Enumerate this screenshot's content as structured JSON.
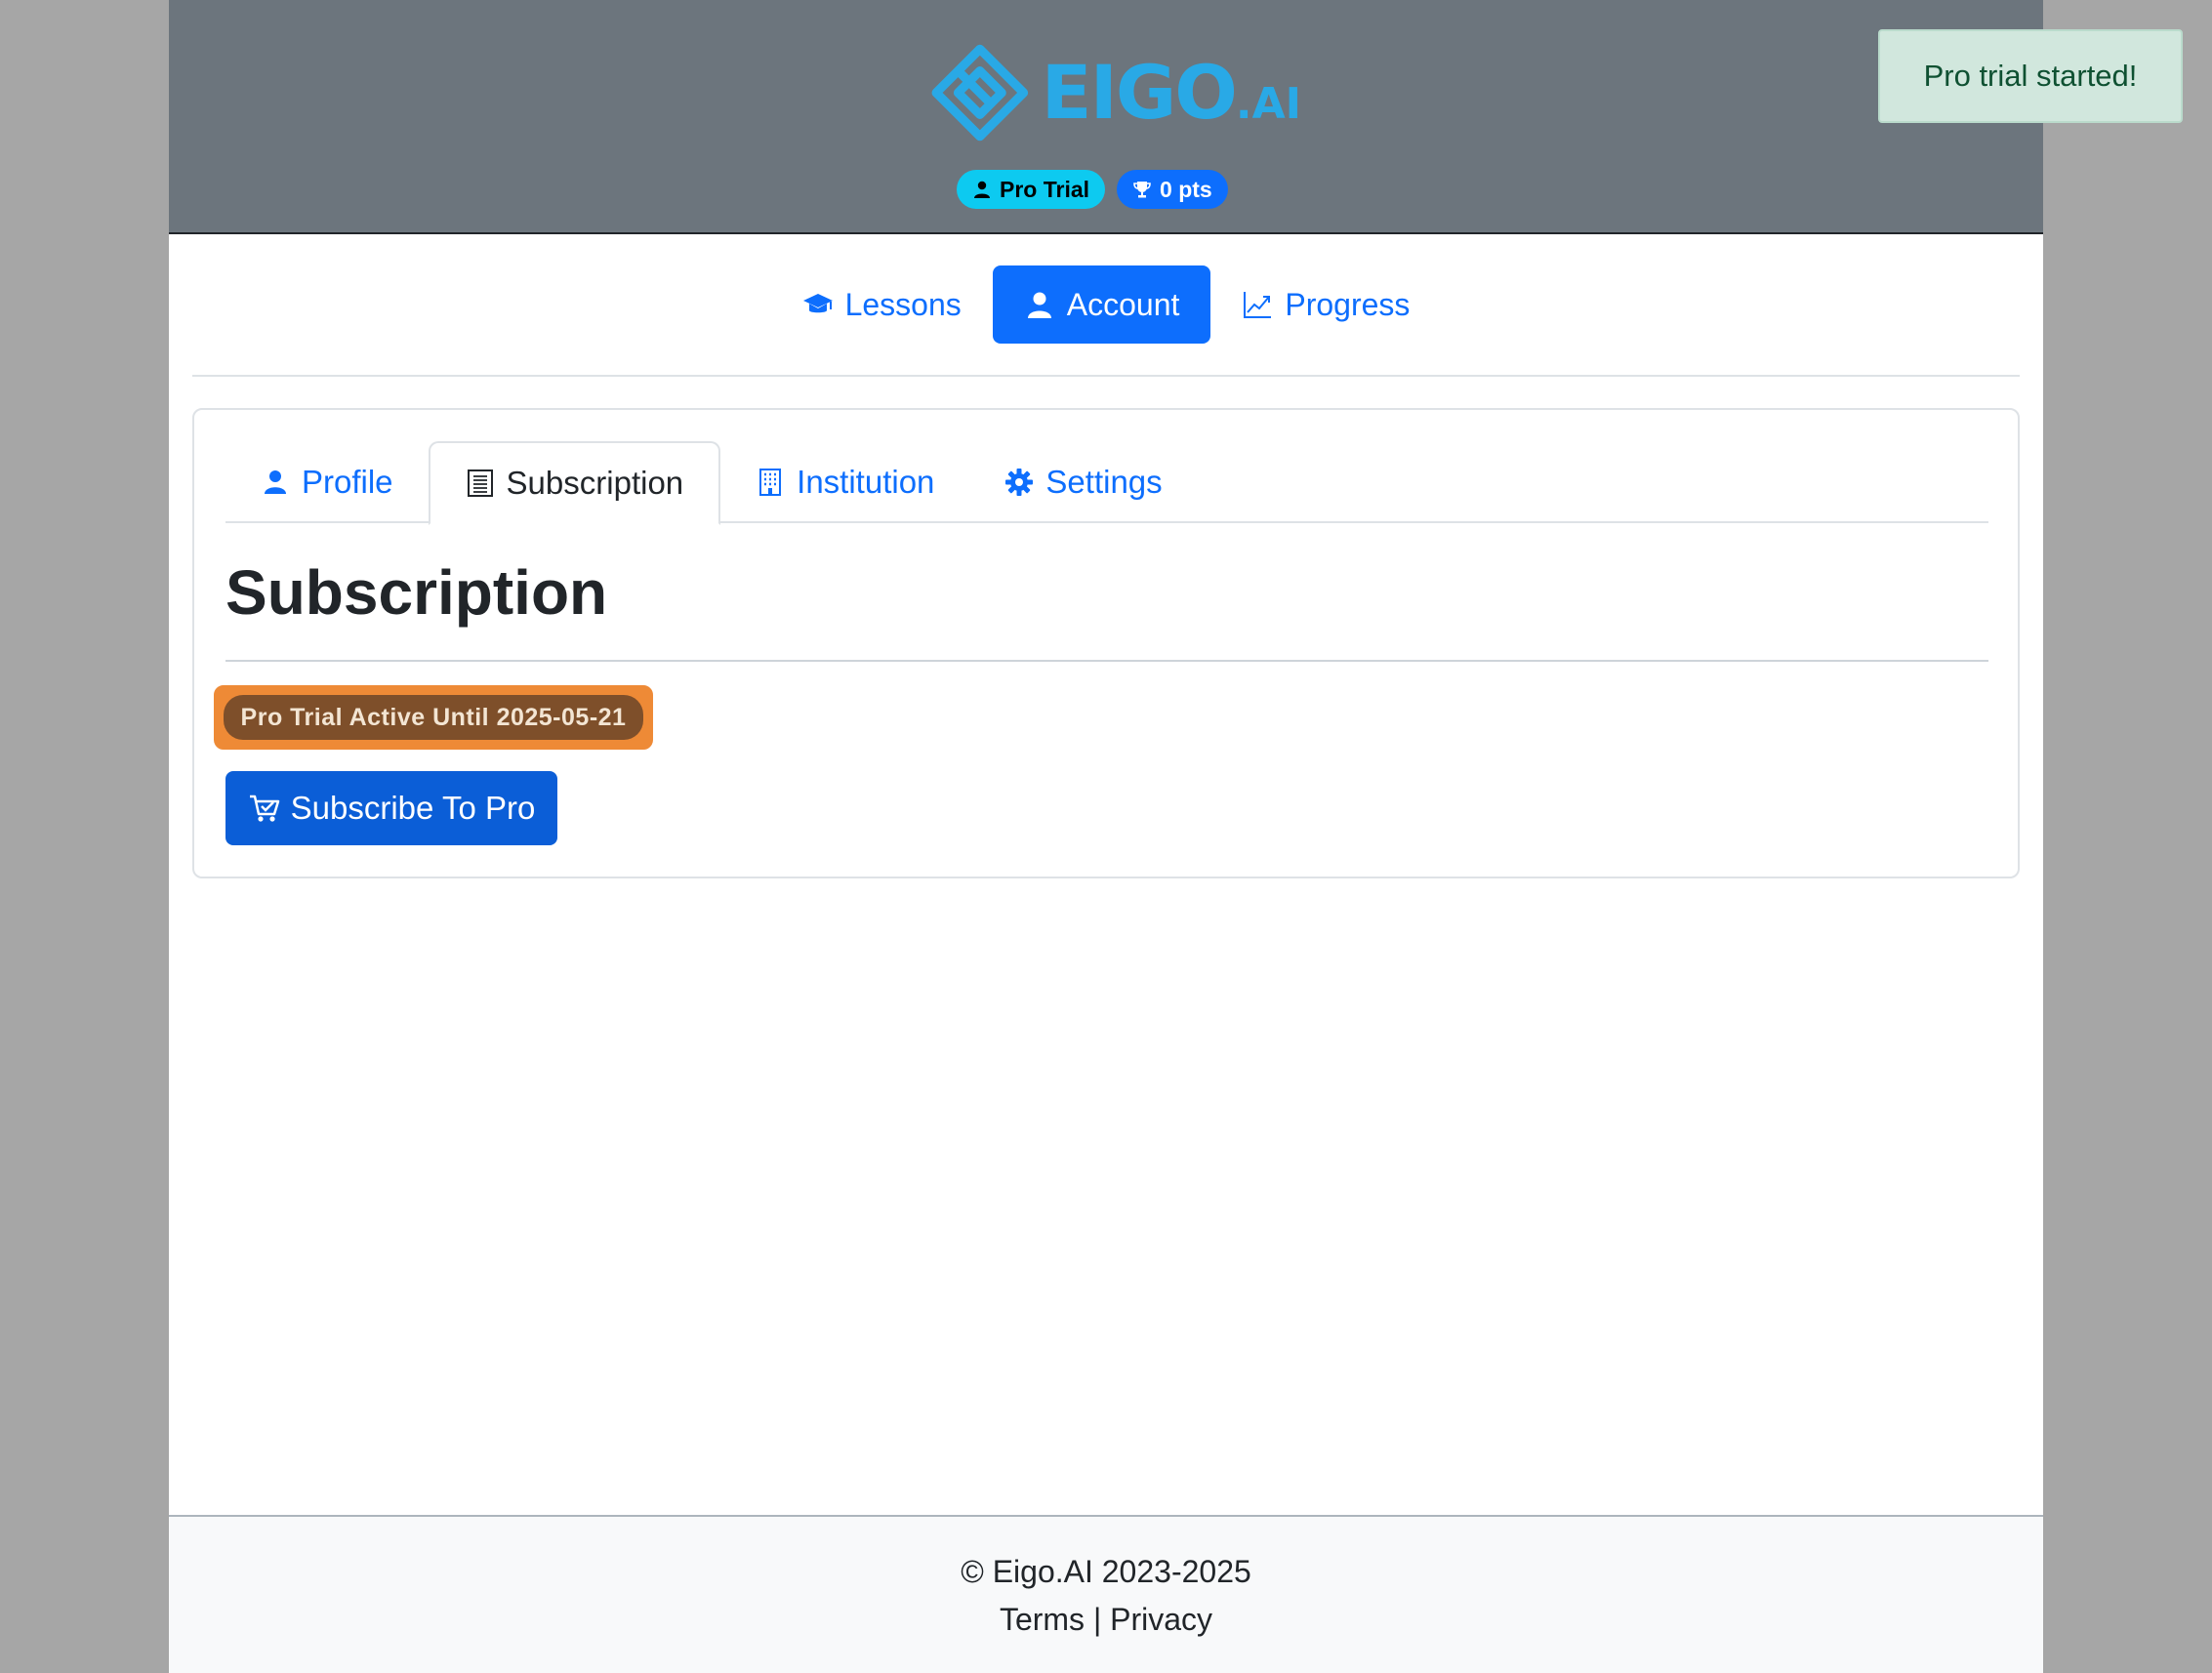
{
  "header": {
    "logo": {
      "brand": "EIGO",
      "suffix": ".AI",
      "color": "#29a9e6"
    },
    "badges": {
      "plan": {
        "label": "Pro Trial",
        "icon": "user-icon"
      },
      "points": {
        "label": "0 pts",
        "icon": "trophy-icon"
      }
    }
  },
  "main_nav": {
    "items": [
      {
        "label": "Lessons",
        "icon": "graduation-cap-icon",
        "active": false
      },
      {
        "label": "Account",
        "icon": "user-icon",
        "active": true
      },
      {
        "label": "Progress",
        "icon": "chart-line-icon",
        "active": false
      }
    ]
  },
  "account_tabs": {
    "items": [
      {
        "label": "Profile",
        "icon": "user-icon",
        "active": false
      },
      {
        "label": "Subscription",
        "icon": "receipt-icon",
        "active": true
      },
      {
        "label": "Institution",
        "icon": "building-icon",
        "active": false
      },
      {
        "label": "Settings",
        "icon": "gear-icon",
        "active": false
      }
    ]
  },
  "subscription": {
    "title": "Subscription",
    "status": "Pro Trial Active Until 2025-05-21",
    "subscribe_button": "Subscribe To Pro"
  },
  "footer": {
    "copyright": "© Eigo.AI 2023-2025",
    "terms": "Terms",
    "separator": "|",
    "privacy": "Privacy"
  },
  "toast": {
    "message": "Pro trial started!"
  },
  "colors": {
    "primary": "#0d6efd",
    "header_bg": "#6c757d",
    "info": "#0dcaf0",
    "toast_bg": "#d1e7dd",
    "highlight": "#ee8a36"
  }
}
